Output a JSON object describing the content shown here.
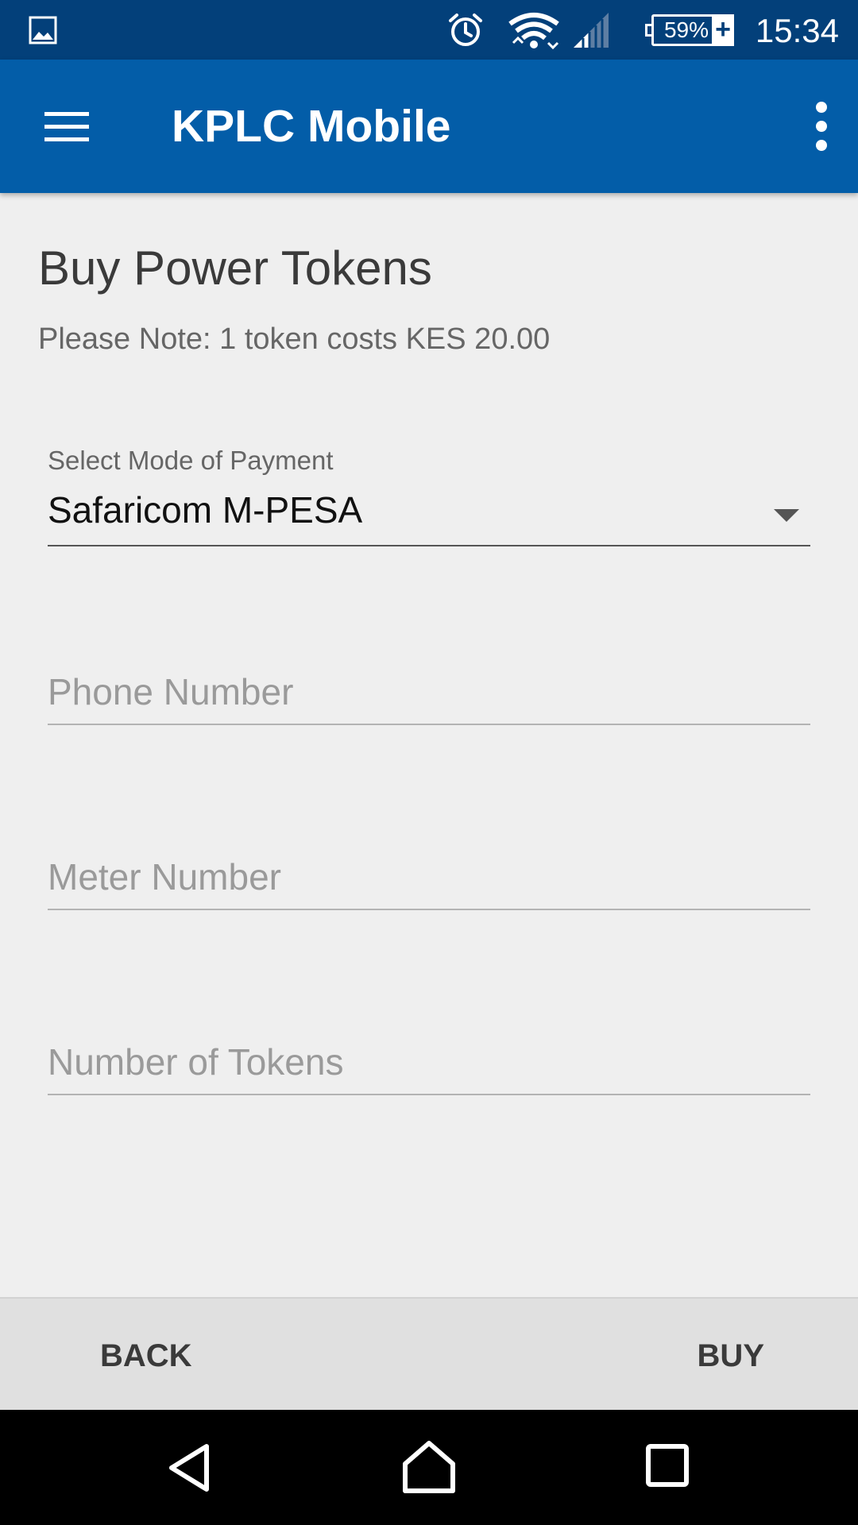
{
  "status_bar": {
    "battery_percent": "59%",
    "charge_symbol": "+",
    "time": "15:34",
    "icons": [
      "gallery-icon",
      "alarm-icon",
      "wifi-icon",
      "signal-icon",
      "battery-icon"
    ]
  },
  "app_bar": {
    "title": "KPLC Mobile",
    "icons": [
      "menu-icon",
      "overflow-menu-icon"
    ]
  },
  "page": {
    "title": "Buy Power Tokens",
    "note": "Please Note: 1 token costs KES 20.00"
  },
  "form": {
    "payment_label": "Select Mode of Payment",
    "payment_value": "Safaricom M-PESA",
    "phone_placeholder": "Phone Number",
    "phone_value": "",
    "meter_placeholder": "Meter Number",
    "meter_value": "",
    "tokens_placeholder": "Number of Tokens",
    "tokens_value": ""
  },
  "actions": {
    "back_label": "BACK",
    "buy_label": "BUY"
  },
  "nav": {
    "icons": [
      "nav-back-icon",
      "nav-home-icon",
      "nav-recents-icon"
    ]
  },
  "colors": {
    "status_bar": "#03407a",
    "app_bar": "#035da8",
    "background": "#efefef",
    "action_bar": "#e0e0e0"
  }
}
